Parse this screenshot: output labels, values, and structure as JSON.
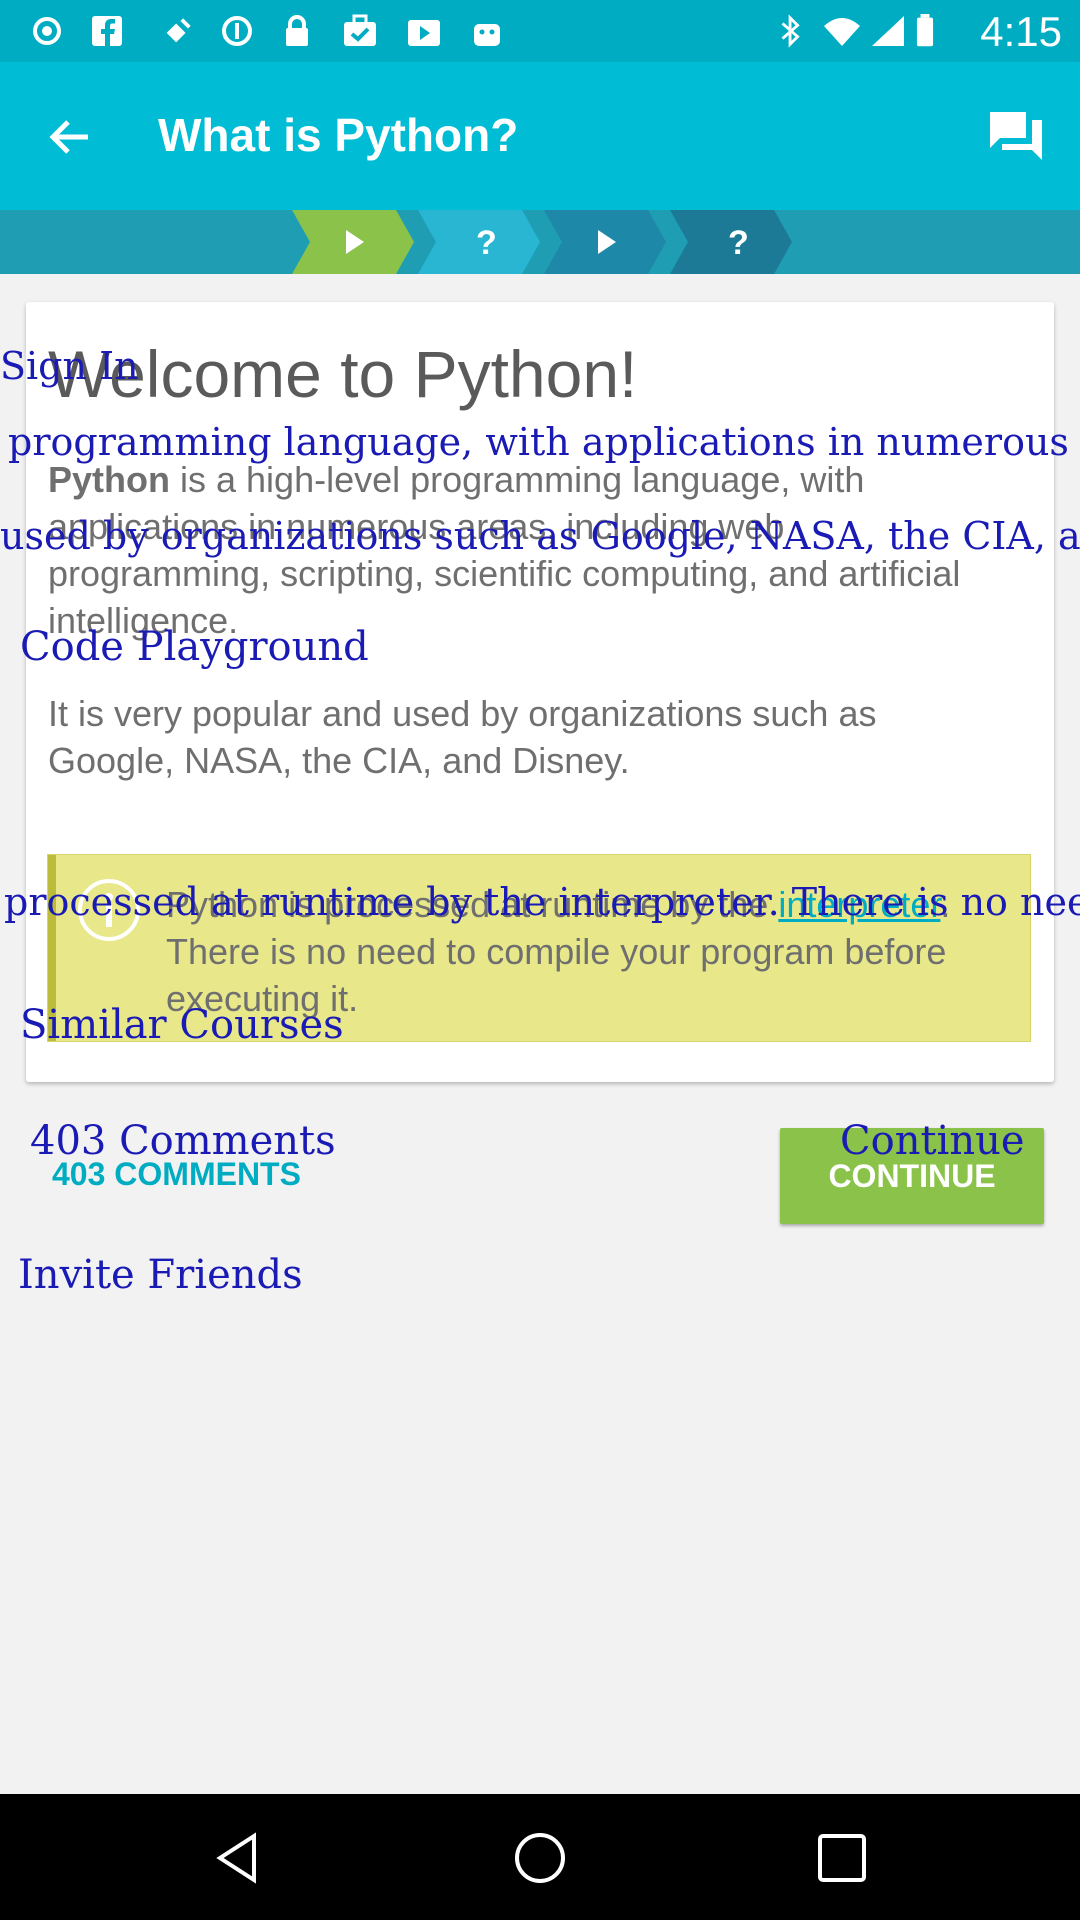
{
  "status_bar": {
    "time": "4:15",
    "icons": [
      "notification-dot-icon",
      "facebook-icon",
      "satellite-icon",
      "privacy-icon",
      "lock-icon",
      "briefcase-icon",
      "play-store-icon",
      "android-icon",
      "bluetooth-icon",
      "wifi-icon",
      "signal-icon",
      "battery-icon"
    ]
  },
  "app_bar": {
    "title": "What is Python?",
    "back_icon": "back-arrow-icon",
    "comments_icon": "comments-icon"
  },
  "progress": {
    "steps": [
      {
        "type": "play",
        "icon": "play-icon",
        "state": "completed",
        "color": "#8bc34a"
      },
      {
        "type": "quiz",
        "icon": "question-icon",
        "state": "pending",
        "color": "#29b6d3"
      },
      {
        "type": "play",
        "icon": "play-icon",
        "state": "pending",
        "color": "#1e88a8"
      },
      {
        "type": "quiz",
        "icon": "question-icon",
        "state": "pending",
        "color": "#1c7a96"
      }
    ]
  },
  "lesson": {
    "title": "Welcome to Python!",
    "p1_bold": "Python",
    "p1_rest": " is a high-level programming language, with applications in numerous areas, including web programming, scripting, scientific computing, and artificial intelligence.",
    "p2": "It is very popular and used by organizations such as Google, NASA, the CIA, and Disney.",
    "note_pre": "Python is processed at runtime by the ",
    "note_link": "interpreter",
    "note_post": ". There is no need to compile your program before executing it.",
    "note_icon": "info-icon"
  },
  "actions": {
    "comments": "403 COMMENTS",
    "continue": "CONTINUE"
  },
  "overlay_labels": {
    "sign_in": "Sign In",
    "p1_fragment": "programming language, with applications in numerous",
    "p2_fragment": "used by organizations such as Google, NASA, the CIA, an",
    "code_playground": "Code Playground",
    "note_fragment": "processed at runtime by the interpreter. There is no nee",
    "similar_courses": "Similar Courses",
    "comments": "403 Comments",
    "continue": "Continue",
    "invite_friends": "Invite Friends"
  },
  "nav_bar": {
    "back": "nav-back-icon",
    "home": "nav-home-icon",
    "recents": "nav-recents-icon"
  }
}
